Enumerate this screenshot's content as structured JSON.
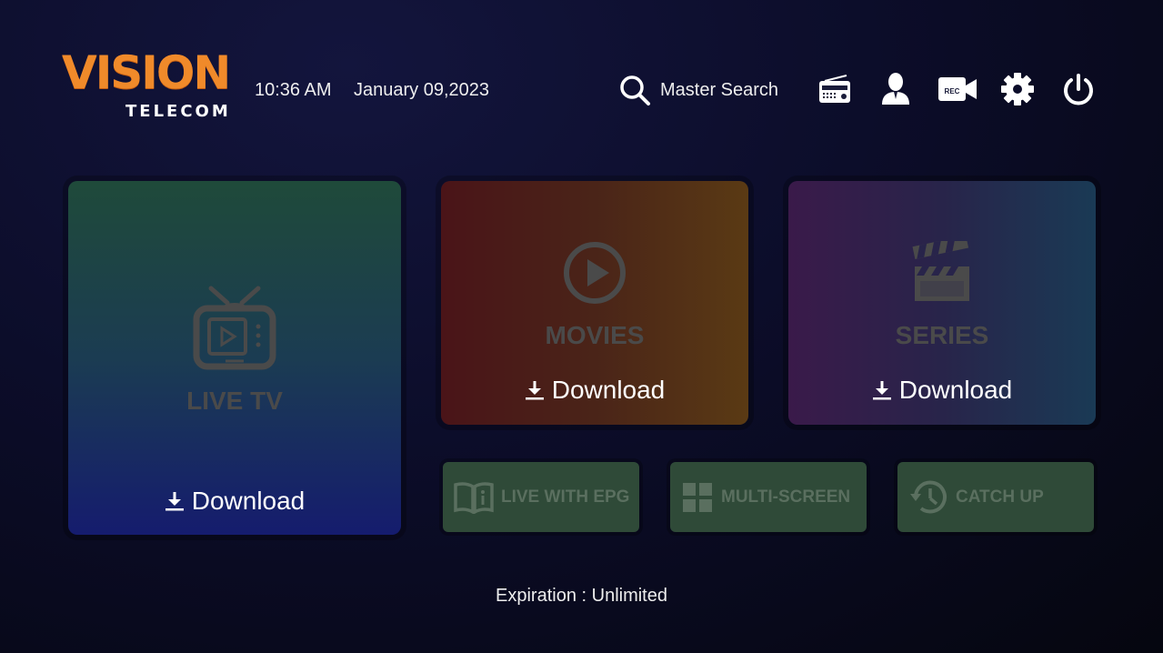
{
  "header": {
    "logo_main": "VISION",
    "logo_sub": "TELECOM",
    "time": "10:36 AM",
    "date": "January 09,2023",
    "search_label": "Master Search",
    "icons": [
      "search-icon",
      "radio-icon",
      "user-icon",
      "rec-camera-icon",
      "gear-icon",
      "power-icon"
    ],
    "rec_label": "REC"
  },
  "cards": {
    "livetv": {
      "title": "LIVE TV",
      "download": "Download"
    },
    "movies": {
      "title": "MOVIES",
      "download": "Download"
    },
    "series": {
      "title": "SERIES",
      "download": "Download"
    }
  },
  "small_buttons": {
    "epg": "LIVE WITH EPG",
    "multiscreen": "MULTI-SCREEN",
    "catchup": "CATCH UP"
  },
  "footer": {
    "expiration_label": "Expiration : ",
    "expiration_value": "Unlimited"
  },
  "colors": {
    "brand_orange": "#f08a2a",
    "card_title_gray": "#4a4a4a",
    "small_button_bg": "#2f4a38"
  }
}
